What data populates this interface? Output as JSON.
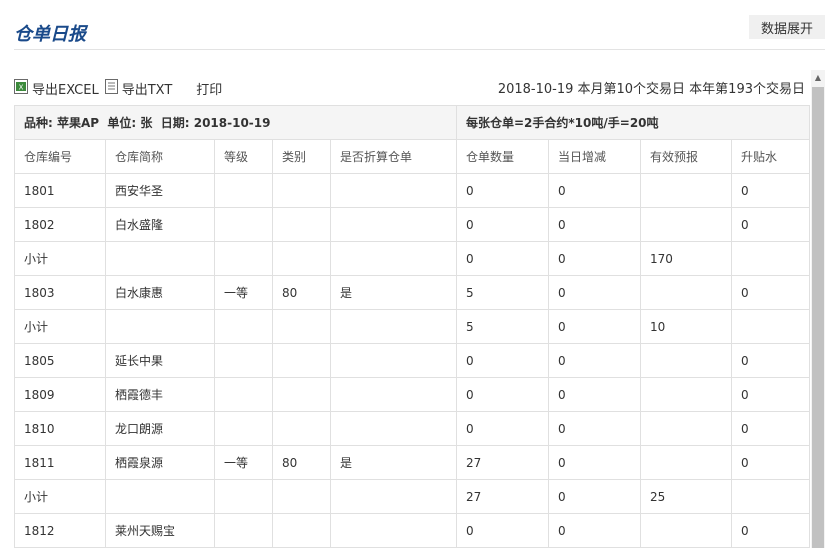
{
  "page_title": "仓单日报",
  "expand_label": "数据展开",
  "toolbar": {
    "export_excel": "导出EXCEL",
    "export_txt": "导出TXT",
    "print": "打印"
  },
  "trade_info": "2018-10-19 本月第10个交易日 本年第193个交易日",
  "meta": {
    "left": "品种: 苹果AP  单位: 张  日期: 2018-10-19",
    "right": "每张仓单=2手合约*10吨/手=20吨"
  },
  "columns": [
    "仓库编号",
    "仓库简称",
    "等级",
    "类别",
    "是否折算仓单",
    "仓单数量",
    "当日增减",
    "有效预报",
    "升贴水"
  ],
  "rows": [
    [
      "1801",
      "西安华圣",
      "",
      "",
      "",
      "0",
      "0",
      "",
      "0"
    ],
    [
      "1802",
      "白水盛隆",
      "",
      "",
      "",
      "0",
      "0",
      "",
      "0"
    ],
    [
      "小计",
      "",
      "",
      "",
      "",
      "0",
      "0",
      "170",
      ""
    ],
    [
      "1803",
      "白水康惠",
      "一等",
      "80",
      "是",
      "5",
      "0",
      "",
      "0"
    ],
    [
      "小计",
      "",
      "",
      "",
      "",
      "5",
      "0",
      "10",
      ""
    ],
    [
      "1805",
      "延长中果",
      "",
      "",
      "",
      "0",
      "0",
      "",
      "0"
    ],
    [
      "1809",
      "栖霞德丰",
      "",
      "",
      "",
      "0",
      "0",
      "",
      "0"
    ],
    [
      "1810",
      "龙口朗源",
      "",
      "",
      "",
      "0",
      "0",
      "",
      "0"
    ],
    [
      "1811",
      "栖霞泉源",
      "一等",
      "80",
      "是",
      "27",
      "0",
      "",
      "0"
    ],
    [
      "小计",
      "",
      "",
      "",
      "",
      "27",
      "0",
      "25",
      ""
    ],
    [
      "1812",
      "莱州天赐宝",
      "",
      "",
      "",
      "0",
      "0",
      "",
      "0"
    ]
  ]
}
